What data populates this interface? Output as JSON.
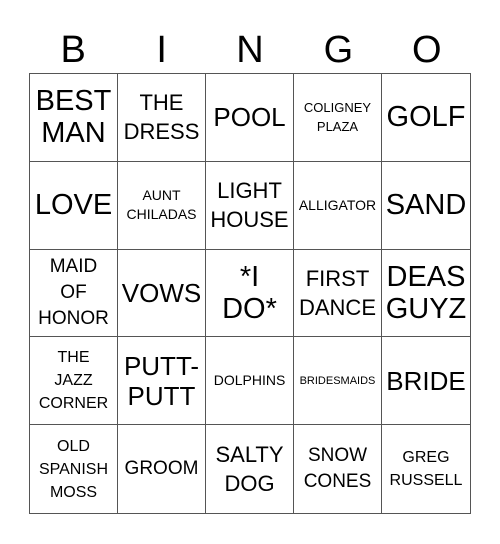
{
  "header": {
    "letters": [
      "B",
      "I",
      "N",
      "G",
      "O"
    ]
  },
  "cells": [
    "BEST\nMAN",
    "THE\nDRESS",
    "POOL",
    "COLIGNEY\nPLAZA",
    "GOLF",
    "LOVE",
    "AUNT\nCHILADAS",
    "LIGHT\nHOUSE",
    "ALLIGATOR",
    "SAND",
    "MAID\nOF\nHONOR",
    "VOWS",
    "*I\nDO*",
    "FIRST\nDANCE",
    "DEAS\nGUYZ",
    "THE\nJAZZ\nCORNER",
    "PUTT-\nPUTT",
    "DOLPHINS",
    "BRIDESMAIDS",
    "BRIDE",
    "OLD\nSPANISH\nMOSS",
    "GROOM",
    "SALTY\nDOG",
    "SNOW\nCONES",
    "GREG\nRUSSELL"
  ]
}
